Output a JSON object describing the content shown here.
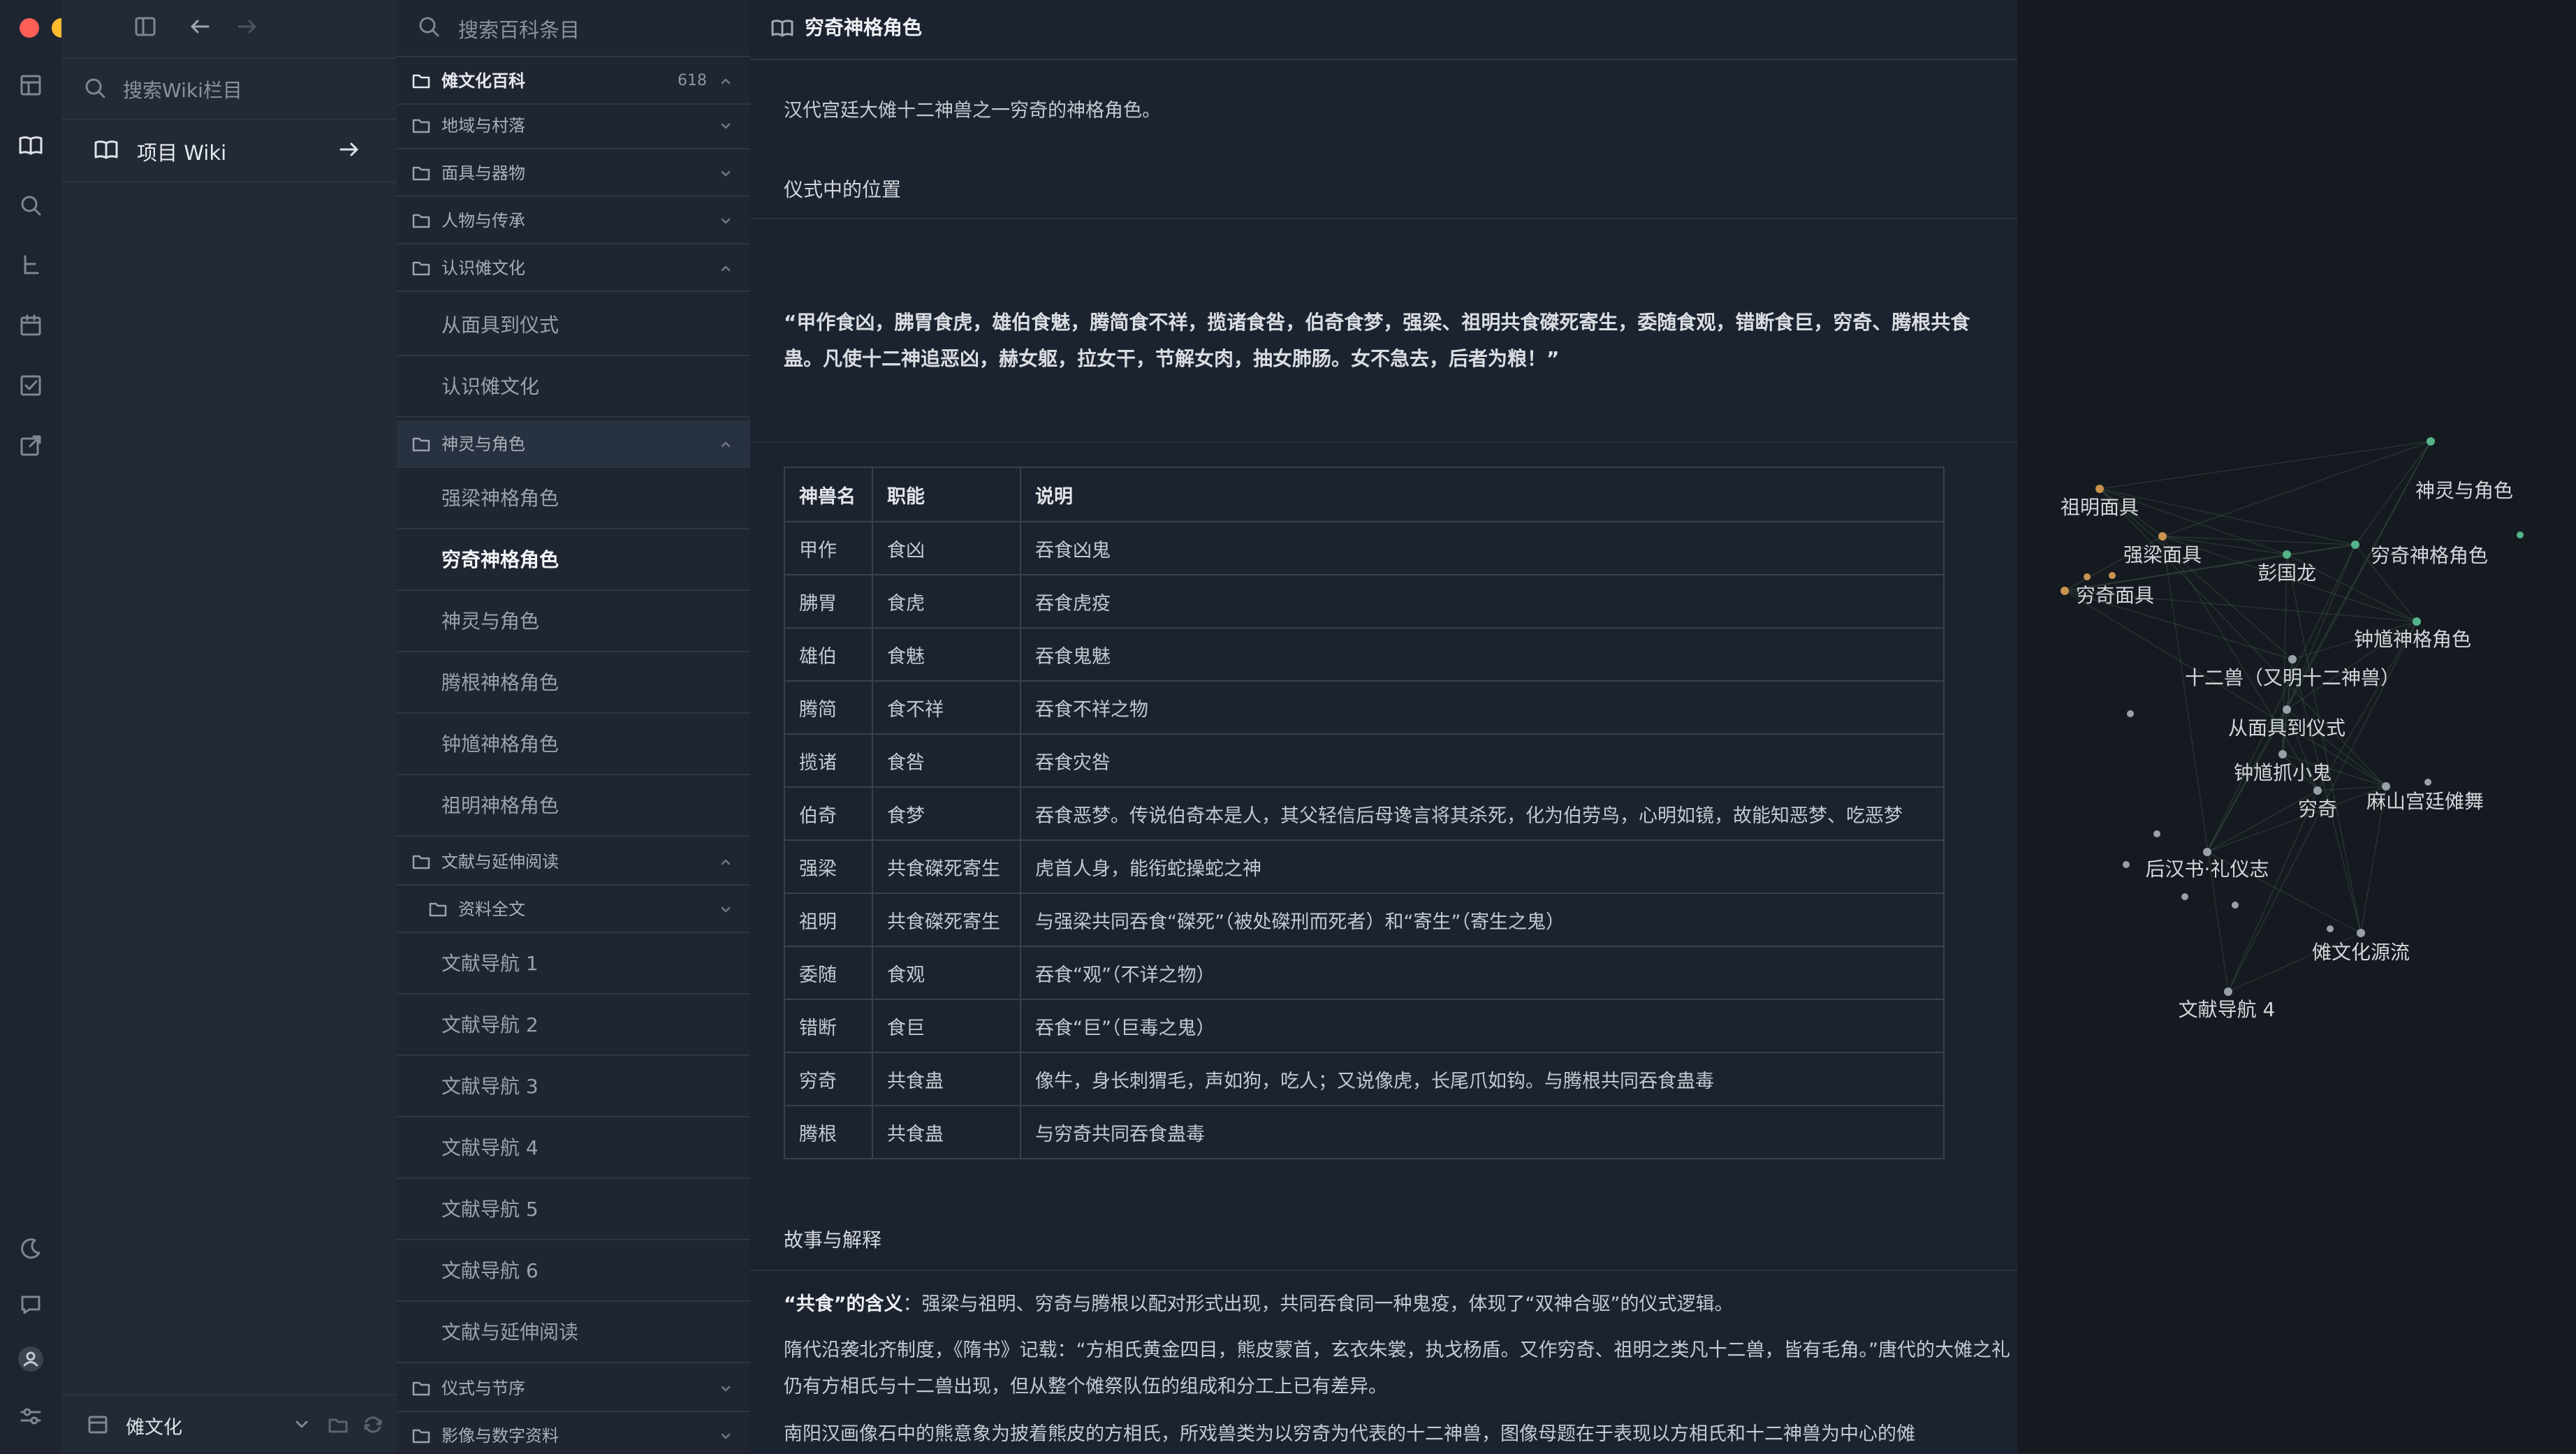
{
  "wiki_panel": {
    "search_placeholder": "搜索Wiki栏目",
    "item_label": "项目 Wiki",
    "workspace_name": "傩文化"
  },
  "tree": {
    "search_placeholder": "搜索百科条目",
    "root": {
      "label": "傩文化百科",
      "count": "618"
    },
    "rows": [
      {
        "label": "地域与村落"
      },
      {
        "label": "面具与器物"
      },
      {
        "label": "人物与传承"
      },
      {
        "label": "认识傩文化"
      },
      {
        "label": "从面具到仪式"
      },
      {
        "label": "认识傩文化"
      },
      {
        "label": "神灵与角色"
      },
      {
        "label": "强梁神格角色"
      },
      {
        "label": "穷奇神格角色"
      },
      {
        "label": "神灵与角色"
      },
      {
        "label": "腾根神格角色"
      },
      {
        "label": "钟馗神格角色"
      },
      {
        "label": "祖明神格角色"
      },
      {
        "label": "文献与延伸阅读"
      },
      {
        "label": "资料全文"
      },
      {
        "label": "文献导航 1"
      },
      {
        "label": "文献导航 2"
      },
      {
        "label": "文献导航 3"
      },
      {
        "label": "文献导航 4"
      },
      {
        "label": "文献导航 5"
      },
      {
        "label": "文献导航 6"
      },
      {
        "label": "文献与延伸阅读"
      },
      {
        "label": "仪式与节序"
      },
      {
        "label": "影像与数字资料"
      }
    ]
  },
  "page": {
    "title": "穷奇神格角色",
    "intro": "汉代宫廷大傩十二神兽之一穷奇的神格角色。",
    "section1": "仪式中的位置",
    "quote_line1": "“甲作食凶，胇胃食虎，雄伯食魅，腾简食不祥，揽诸食咎，伯奇食梦，强梁、祖明共食磔死寄生，委随食观，错断食巨，穷奇、腾根共食",
    "quote_line2": "蛊。凡使十二神追恶凶，赫女躯，拉女干，节解女肉，抽女肺肠。女不急去，后者为粮！”",
    "table": {
      "headers": [
        "神兽名",
        "职能",
        "说明"
      ],
      "rows": [
        [
          "甲作",
          "食凶",
          "吞食凶鬼"
        ],
        [
          "胇胃",
          "食虎",
          "吞食虎疫"
        ],
        [
          "雄伯",
          "食魅",
          "吞食鬼魅"
        ],
        [
          "腾简",
          "食不祥",
          "吞食不祥之物"
        ],
        [
          "揽诸",
          "食咎",
          "吞食灾咎"
        ],
        [
          "伯奇",
          "食梦",
          "吞食恶梦。传说伯奇本是人，其父轻信后母谗言将其杀死，化为伯劳鸟，心明如镜，故能知恶梦、吃恶梦"
        ],
        [
          "强梁",
          "共食磔死寄生",
          "虎首人身，能衔蛇操蛇之神"
        ],
        [
          "祖明",
          "共食磔死寄生",
          "与强梁共同吞食“磔死”（被处磔刑而死者）和“寄生”（寄生之鬼）"
        ],
        [
          "委随",
          "食观",
          "吞食“观”（不详之物）"
        ],
        [
          "错断",
          "食巨",
          "吞食“巨”（巨毒之鬼）"
        ],
        [
          "穷奇",
          "共食蛊",
          "像牛，身长刺猬毛，声如狗，吃人；又说像虎，长尾爪如钩。与腾根共同吞食蛊毒"
        ],
        [
          "腾根",
          "共食蛊",
          "与穷奇共同吞食蛊毒"
        ]
      ]
    },
    "section2": "故事与解释",
    "p1_bold": "“共食”的含义",
    "p1_text": "：强梁与祖明、穷奇与腾根以配对形式出现，共同吞食同一种鬼疫，体现了“双神合驱”的仪式逻辑。",
    "p2": "隋代沿袭北齐制度，《隋书》记载：“方相氏黄金四目，熊皮蒙首，玄衣朱裳，执戈杨盾。又作穷奇、祖明之类凡十二兽，皆有毛角。”唐代的大傩之礼仍有方相氏与十二兽出现，但从整个傩祭队伍的组成和分工上已有差异。",
    "p3": "南阳汉画像石中的熊意象为披着熊皮的方相氏，所戏兽类为以穷奇为代表的十二神兽，图像母题在于表现以方相氏和十二神兽为中心的傩"
  },
  "graph": {
    "labels": [
      "神灵与角色",
      "祖明面具",
      "强梁面具",
      "彭国龙",
      "穷奇神格角色",
      "穷奇面具",
      "钟馗神格角色",
      "十二兽（又明十二神兽）",
      "从面具到仪式",
      "钟馗抓小鬼",
      "穷奇",
      "麻山宫廷傩舞",
      "后汉书·礼仪志",
      "傩文化源流",
      "文献导航 4"
    ],
    "colors": {
      "orange": "#c9924f",
      "green": "#56b48a",
      "gray": "#9aa0a8"
    }
  }
}
